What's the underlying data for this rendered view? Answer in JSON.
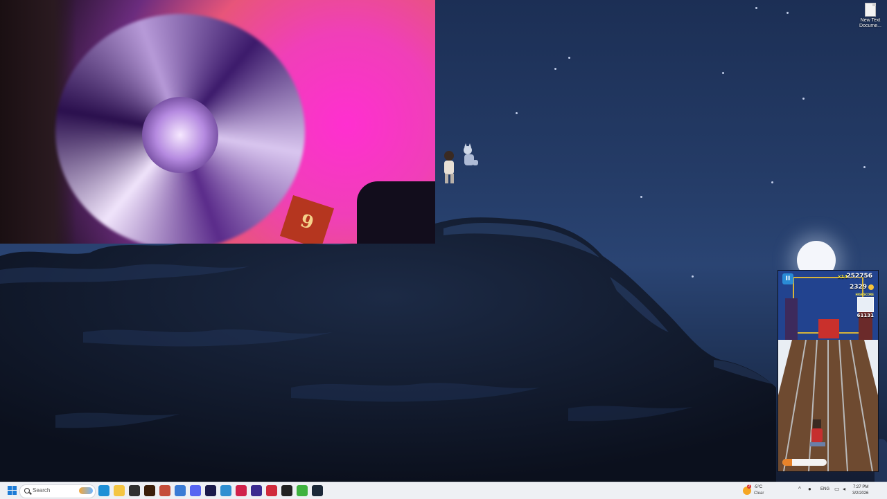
{
  "desktop": {
    "icons": [
      {
        "label": "New Text Docume..."
      }
    ]
  },
  "webcam": {
    "badge_text": "9"
  },
  "game": {
    "pause_glyph": "II",
    "multiplier": "x14",
    "score": "252756",
    "coins": "2329",
    "highscore_label": "HIGHSCORE",
    "highscore_value": "61131",
    "power_level": 0.22
  },
  "taskbar": {
    "search": {
      "placeholder": "Search"
    },
    "pinned_apps": [
      {
        "name": "edge-icon",
        "color": "#1e8fd6"
      },
      {
        "name": "file-explorer-icon",
        "color": "#f4c542"
      },
      {
        "name": "obs-icon",
        "color": "#303030"
      },
      {
        "name": "adobe-illustrator-icon",
        "color": "#3b1f0a"
      },
      {
        "name": "davinci-icon",
        "color": "#c44d3a"
      },
      {
        "name": "store-icon",
        "color": "#3a7bd5"
      },
      {
        "name": "discord-icon",
        "color": "#5865f2"
      },
      {
        "name": "after-effects-icon",
        "color": "#1b1b4a"
      },
      {
        "name": "notepad-icon",
        "color": "#2f8fd1"
      },
      {
        "name": "opera-icon",
        "color": "#d0234b"
      },
      {
        "name": "vpn-icon",
        "color": "#3b2b8f"
      },
      {
        "name": "media-player-icon",
        "color": "#d02b3c"
      },
      {
        "name": "capcut-icon",
        "color": "#222222"
      },
      {
        "name": "robinhood-icon",
        "color": "#3fb23f"
      },
      {
        "name": "steam-icon",
        "color": "#1b2838"
      }
    ],
    "weather": {
      "alert": "2",
      "temp": "-5°C",
      "condition": "Clear"
    },
    "tray": {
      "chevron": "^",
      "language": "ENG"
    },
    "clock": {
      "time": "7:27 PM",
      "date": "3/2/2026"
    }
  }
}
